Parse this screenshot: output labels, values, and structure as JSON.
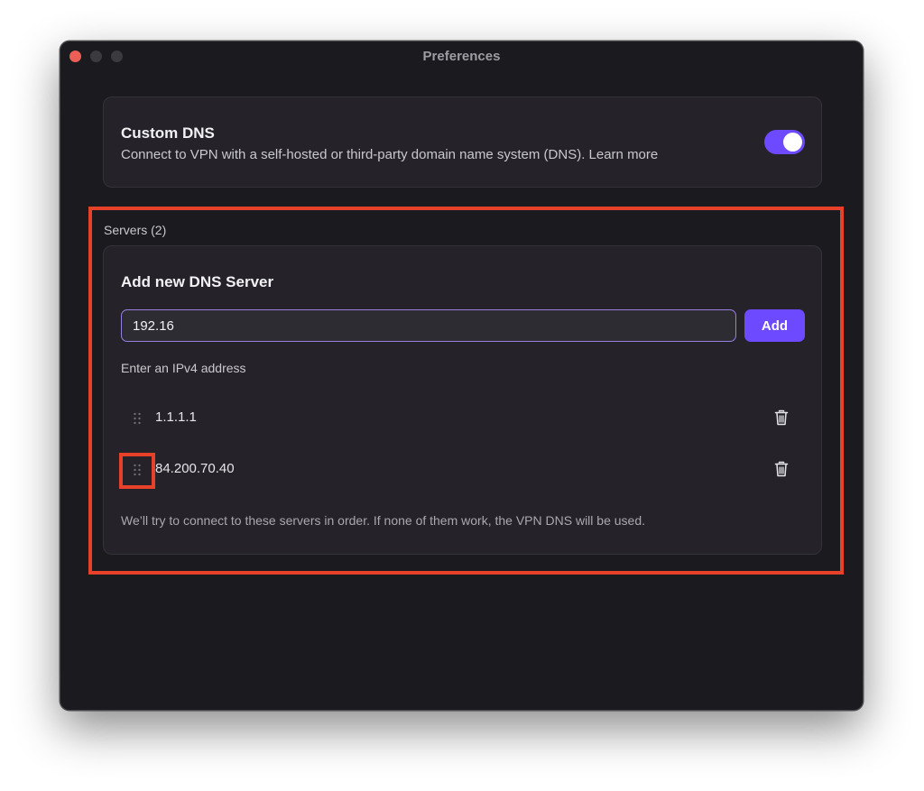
{
  "window": {
    "title": "Preferences"
  },
  "custom_dns": {
    "title": "Custom DNS",
    "description": "Connect to VPN with a self-hosted or third-party domain name system (DNS). Learn more",
    "enabled": true
  },
  "servers": {
    "label": "Servers (2)",
    "add_heading": "Add new DNS Server",
    "input_value": "192.16",
    "add_label": "Add",
    "hint": "Enter an IPv4 address",
    "items": [
      {
        "address": "1.1.1.1"
      },
      {
        "address": "84.200.70.40"
      }
    ],
    "footnote": "We’ll try to connect to these servers in order. If none of them work, the VPN DNS will be used."
  },
  "colors": {
    "accent": "#6d4aff",
    "highlight": "#e8412a",
    "window_bg": "#1b1a1e",
    "card_bg": "#252329"
  },
  "icons": {
    "drag": "drag-handle-icon",
    "delete": "trash-icon"
  }
}
